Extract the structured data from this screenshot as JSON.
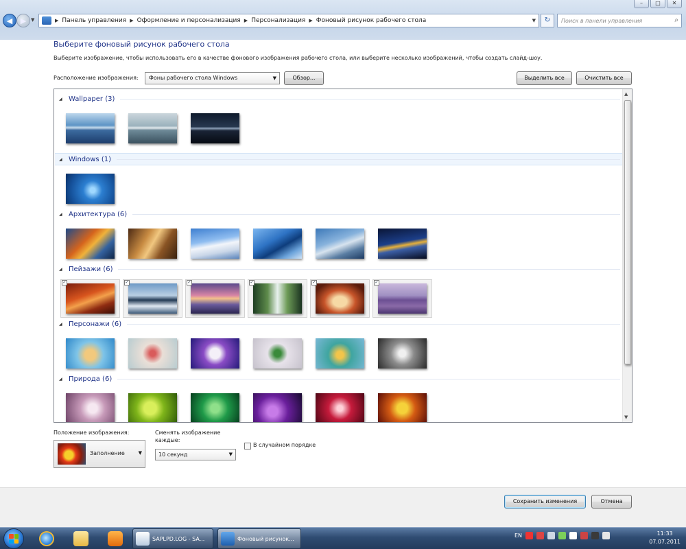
{
  "window": {
    "controls": [
      "–",
      "□",
      "✕"
    ]
  },
  "address": {
    "crumbs": [
      "Панель управления",
      "Оформление и персонализация",
      "Персонализация",
      "Фоновый рисунок рабочего стола"
    ],
    "search_placeholder": "Поиск в панели управления"
  },
  "header": {
    "title": "Выберите фоновый рисунок рабочего стола",
    "subtitle": "Выберите изображение, чтобы использовать его в качестве фонового изображения рабочего стола, или выберите несколько изображений, чтобы создать слайд-шоу."
  },
  "location": {
    "label": "Расположение изображения:",
    "value": "Фоны рабочего стола Windows",
    "browse_label": "Обзор...",
    "select_all_label": "Выделить все",
    "clear_all_label": "Очистить все"
  },
  "groups": [
    {
      "name": "Wallpaper (3)",
      "selected": false,
      "thumbs": [
        "linear-gradient(#bcd6ec 0%, #5d94c5 40%, #c7dbec 48%, #3c6b9f 56%, #1d3d6c 100%)",
        "linear-gradient(#cbd6dc 0%, #9bb2bd 42%, #e5ecef 49%, #6e8a98 56%, #3a505e 100%)",
        "linear-gradient(#0f1a2c 0%, #27384f 45%, #8ea2b9 50%, #1a2436 58%, #060a12 100%)"
      ]
    },
    {
      "name": "Windows (1)",
      "selected": false,
      "thumbs": [
        "radial-gradient(circle at 55% 55%, #9fd8ff 0 8%, #2c7fd1 30%, #15519a 70%, #0c2f63 100%)"
      ]
    },
    {
      "name": "Архитектура (6)",
      "selected": false,
      "thumbs": [
        "linear-gradient(135deg, #1f4a8a 0%, #d5641d 40%, #f0b23a 55%, #34629f 75%, #0e2445 100%)",
        "linear-gradient(120deg, #4c2a14 0%, #c88b42 35%, #f1c780 50%, #8a5424 70%, #3a2210 100%)",
        "linear-gradient(170deg, #3e7fd0 0%, #8fbdf0 40%, #f2f5fa 55%, #c9d6e8 75%, #5a84bc 100%)",
        "linear-gradient(150deg, #7cb6ef 0%, #2e73c4 40%, #0e3d7c 60%, #6aa2da 80%, #cfe3f6 100%)",
        "linear-gradient(160deg, #3c78b8 0%, #87b2dc 40%, #d7e3ee 55%, #5b7ea3 75%, #1c3a62 100%)",
        "linear-gradient(170deg, #0a1536 0%, #1c3f8a 45%, #e6b03a 55%, #3c5fa6 65%, #050a1e 100%)"
      ]
    },
    {
      "name": "Пейзажи (6)",
      "selected": true,
      "thumbs": [
        "linear-gradient(160deg, #7a1d0c 0%, #d8551e 40%, #f3a04b 55%, #8f2c12 75%, #3b0d05 100%)",
        "linear-gradient(#6e9ac6 0%, #b9cfe4 40%, #233a55 55%, #dfe8f1 75%, #3d5a7a 100%)",
        "linear-gradient(#5b4a8c 0%, #d885a5 40%, #f3c18a 50%, #6a5b9c 70%, #2b2550 100%)",
        "linear-gradient(90deg, #1d3d22 0%, #5f8c4c 30%, #e8f1ee 50%, #6d9b57 70%, #1b3320 100%)",
        "radial-gradient(ellipse at 50% 60%, #f6d9a5 0 20%, #c8552a 45%, #5a1c0c 80%)",
        "linear-gradient(#c9b8dc 0%, #a090c2 40%, #6c4f93 55%, #8a6aa8 75%, #4b3570 100%)"
      ]
    },
    {
      "name": "Персонажи (6)",
      "selected": false,
      "thumbs": [
        "radial-gradient(circle at 50% 55%, #f2c97d 0 18%, #7ec4e8 45%, #2f88c9 100%)",
        "radial-gradient(circle at 50% 50%, #d95b5b 0 10%, #eadfd7 35%, #b8ccd0 100%)",
        "radial-gradient(circle at 50% 50%, #f4f0f8 0 18%, #8a4cc5 40%, #241a7a 100%)",
        "radial-gradient(circle at 50% 50%, #3a8a3a 0 12%, #e7e2ea 35%, #c6c2cc 100%)",
        "radial-gradient(circle at 50% 55%, #f3c54a 0 12%, #3fa5a0 40%, #7ab8d6 100%)",
        "radial-gradient(circle at 50% 50%, #f0f0f0 0 12%, #8c8c8c 40%, #2a2a2a 100%)"
      ]
    },
    {
      "name": "Природа (6)",
      "selected": false,
      "thumbs": [
        "radial-gradient(circle at 55% 50%, #f6e8f1 0 15%, #c79ab9 40%, #6d4266 100%)",
        "radial-gradient(circle at 45% 50%, #d9ef5b 0 20%, #7fb51a 45%, #2f5a08 100%)",
        "radial-gradient(circle at 50% 50%, #8fe08a 0 15%, #1f9a49 45%, #063d1d 100%)",
        "radial-gradient(circle at 40% 60%, #c77be8 0 15%, #6a1f9c 45%, #160a2e 100%)",
        "radial-gradient(circle at 50% 50%, #ffd0d8 0 10%, #c61b3c 40%, #4d0614 100%)",
        "radial-gradient(circle at 50% 50%, #f5d23a 0 18%, #d45b13 45%, #5a0d07 100%)"
      ]
    }
  ],
  "position": {
    "label": "Положение изображения:",
    "value": "Заполнение"
  },
  "interval": {
    "label_line1": "Сменять изображение",
    "label_line2": "каждые:",
    "value": "10 секунд"
  },
  "shuffle": {
    "label": "В случайном порядке",
    "checked": false
  },
  "footer": {
    "save_label": "Сохранить изменения",
    "cancel_label": "Отмена"
  },
  "taskbar": {
    "tasks": [
      {
        "label": "SAPLPD.LOG - SA...",
        "active": false
      },
      {
        "label": "Фоновый рисунок...",
        "active": true
      }
    ],
    "language": "EN",
    "time": "11:33",
    "date": "07.07.2011"
  }
}
